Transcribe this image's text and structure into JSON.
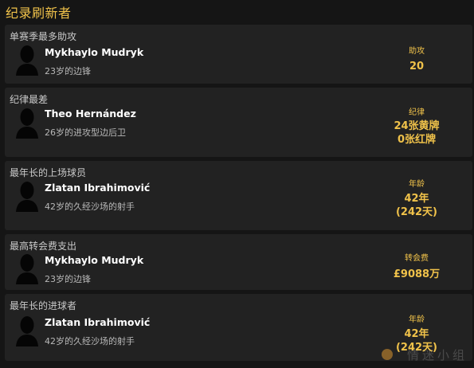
{
  "section_title": "纪录刷新者",
  "records": [
    {
      "category": "单赛季最多助攻",
      "player": "Mykhaylo Mudryk",
      "description": "23岁的边锋",
      "stat_label": "助攻",
      "stat_lines": [
        "20"
      ]
    },
    {
      "category": "纪律最差",
      "player": "Theo Hernández",
      "description": "26岁的进攻型边后卫",
      "stat_label": "纪律",
      "stat_lines": [
        "24张黄牌",
        "0张红牌"
      ]
    },
    {
      "category": "最年长的上场球员",
      "player": "Zlatan Ibrahimović",
      "description": "42岁的久经沙场的射手",
      "stat_label": "年龄",
      "stat_lines": [
        "42年",
        "(242天)"
      ]
    },
    {
      "category": "最高转会费支出",
      "player": "Mykhaylo Mudryk",
      "description": "23岁的边锋",
      "stat_label": "转会费",
      "stat_lines": [
        "£9088万"
      ]
    },
    {
      "category": "最年长的进球者",
      "player": "Zlatan Ibrahimović",
      "description": "42岁的久经沙场的射手",
      "stat_label": "年龄",
      "stat_lines": [
        "42年",
        "(242天)"
      ]
    }
  ],
  "watermark": "情迷小组"
}
